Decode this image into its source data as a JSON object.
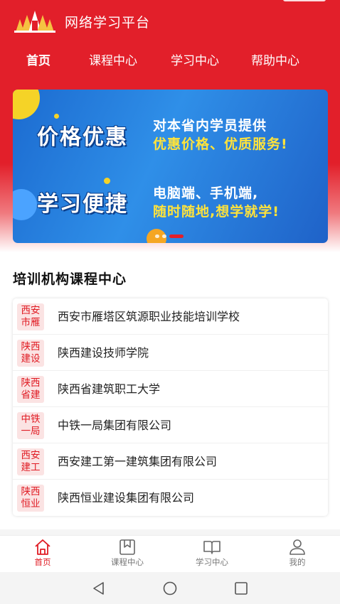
{
  "app": {
    "title": "网络学习平台"
  },
  "topnav": {
    "tabs": [
      "首页",
      "课程中心",
      "学习中心",
      "帮助中心"
    ]
  },
  "banner": {
    "headline1": "价格优惠",
    "text1_line1": "对本省内学员提供",
    "text1_line2": "优惠价格、优质服务!",
    "headline2": "学习便捷",
    "text2_line1": "电脑端、手机端,",
    "text2_line2": "随时随地,想学就学!",
    "active_slide": 3,
    "slide_count": 3
  },
  "section": {
    "title": "培训机构课程中心"
  },
  "orgs": [
    {
      "tag1": "西安",
      "tag2": "市雁",
      "name": "西安市雁塔区筑源职业技能培训学校"
    },
    {
      "tag1": "陕西",
      "tag2": "建设",
      "name": "陕西建设技师学院"
    },
    {
      "tag1": "陕西",
      "tag2": "省建",
      "name": "陕西省建筑职工大学"
    },
    {
      "tag1": "中铁",
      "tag2": "一局",
      "name": "中铁一局集团有限公司"
    },
    {
      "tag1": "西安",
      "tag2": "建工",
      "name": "西安建工第一建筑集团有限公司"
    },
    {
      "tag1": "陕西",
      "tag2": "恒业",
      "name": "陕西恒业建设集团有限公司"
    }
  ],
  "bottomnav": {
    "items": [
      {
        "label": "首页",
        "icon": "home-icon",
        "active": true
      },
      {
        "label": "课程中心",
        "icon": "bookmark-icon",
        "active": false
      },
      {
        "label": "学习中心",
        "icon": "open-book-icon",
        "active": false
      },
      {
        "label": "我的",
        "icon": "user-icon",
        "active": false
      }
    ]
  },
  "colors": {
    "brand": "#e21f2a",
    "tag_bg": "#fbe3e3",
    "tag_text": "#e01c24",
    "banner_blue": "#2f8fe8",
    "banner_yellow": "#ffe33b"
  }
}
